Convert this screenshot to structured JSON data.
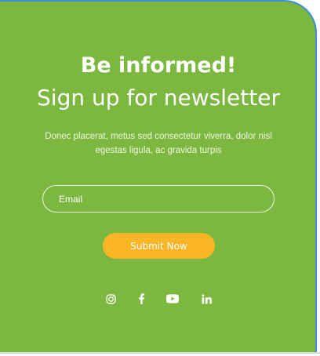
{
  "heading": {
    "title": "Be informed!",
    "subtitle": "Sign up for newsletter"
  },
  "description": "Donec placerat, metus sed consectetur viverra, dolor nisl egestas ligula, ac gravida turpis",
  "form": {
    "email_placeholder": "Email",
    "submit_label": "Submit Now"
  },
  "social": [
    "instagram-icon",
    "facebook-icon",
    "youtube-icon",
    "linkedin-icon"
  ],
  "colors": {
    "background": "#7cb83f",
    "button": "#f9b526",
    "text": "#ffffff"
  }
}
